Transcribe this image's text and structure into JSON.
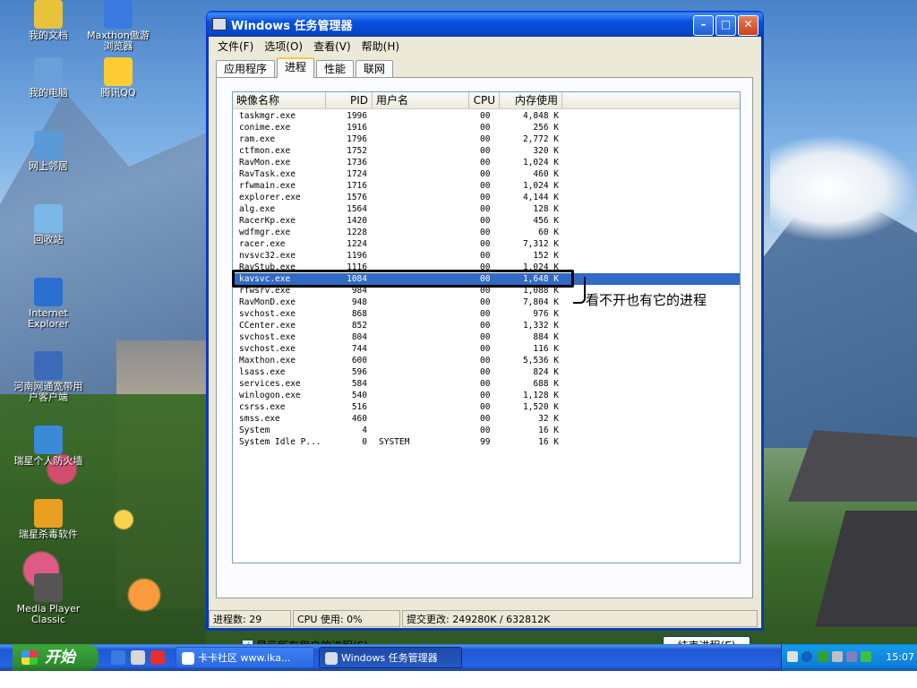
{
  "desktop": {
    "icons": [
      {
        "label": "我的文档",
        "color": "#e8c23a"
      },
      {
        "label": "Maxthon傲游浏览器",
        "color": "#3a7ae0"
      },
      {
        "label": "我的电脑",
        "color": "#6aa0d8"
      },
      {
        "label": "腾讯QQ",
        "color": "#ffcc33"
      },
      {
        "label": "网上邻居",
        "color": "#5a9ad8"
      },
      {
        "label": "回收站",
        "color": "#7ab8e8"
      },
      {
        "label": "Internet Explorer",
        "color": "#2a70d0"
      },
      {
        "label": "河南网通宽带用户客户端",
        "color": "#3a6ab8"
      },
      {
        "label": "瑞星个人防火墙",
        "color": "#3a8ad8"
      },
      {
        "label": "瑞星杀毒软件",
        "color": "#e8a020"
      },
      {
        "label": "Media Player Classic",
        "color": "#555555"
      }
    ]
  },
  "window": {
    "title": "Windows 任务管理器",
    "menu": [
      "文件(F)",
      "选项(O)",
      "查看(V)",
      "帮助(H)"
    ],
    "tabs": [
      "应用程序",
      "进程",
      "性能",
      "联网"
    ],
    "active_tab": "进程",
    "columns": [
      "映像名称",
      "PID",
      "用户名",
      "CPU",
      "内存使用"
    ],
    "processes": [
      {
        "name": "taskmgr.exe",
        "pid": "1996",
        "user": "",
        "cpu": "00",
        "mem": "4,848 K"
      },
      {
        "name": "conime.exe",
        "pid": "1916",
        "user": "",
        "cpu": "00",
        "mem": "256 K"
      },
      {
        "name": "ram.exe",
        "pid": "1796",
        "user": "",
        "cpu": "00",
        "mem": "2,772 K"
      },
      {
        "name": "ctfmon.exe",
        "pid": "1752",
        "user": "",
        "cpu": "00",
        "mem": "320 K"
      },
      {
        "name": "RavMon.exe",
        "pid": "1736",
        "user": "",
        "cpu": "00",
        "mem": "1,024 K"
      },
      {
        "name": "RavTask.exe",
        "pid": "1724",
        "user": "",
        "cpu": "00",
        "mem": "460 K"
      },
      {
        "name": "rfwmain.exe",
        "pid": "1716",
        "user": "",
        "cpu": "00",
        "mem": "1,024 K"
      },
      {
        "name": "explorer.exe",
        "pid": "1576",
        "user": "",
        "cpu": "00",
        "mem": "4,144 K"
      },
      {
        "name": "alg.exe",
        "pid": "1564",
        "user": "",
        "cpu": "00",
        "mem": "128 K"
      },
      {
        "name": "RacerKp.exe",
        "pid": "1420",
        "user": "",
        "cpu": "00",
        "mem": "456 K"
      },
      {
        "name": "wdfmgr.exe",
        "pid": "1228",
        "user": "",
        "cpu": "00",
        "mem": "60 K"
      },
      {
        "name": "racer.exe",
        "pid": "1224",
        "user": "",
        "cpu": "00",
        "mem": "7,312 K"
      },
      {
        "name": "nvsvc32.exe",
        "pid": "1196",
        "user": "",
        "cpu": "00",
        "mem": "152 K"
      },
      {
        "name": "RavStub.exe",
        "pid": "1116",
        "user": "",
        "cpu": "00",
        "mem": "1,024 K"
      },
      {
        "name": "kavsvc.exe",
        "pid": "1084",
        "user": "",
        "cpu": "00",
        "mem": "1,648 K",
        "selected": true
      },
      {
        "name": "rfwsrv.exe",
        "pid": "984",
        "user": "",
        "cpu": "00",
        "mem": "1,088 K"
      },
      {
        "name": "RavMonD.exe",
        "pid": "948",
        "user": "",
        "cpu": "00",
        "mem": "7,804 K"
      },
      {
        "name": "svchost.exe",
        "pid": "868",
        "user": "",
        "cpu": "00",
        "mem": "976 K"
      },
      {
        "name": "CCenter.exe",
        "pid": "852",
        "user": "",
        "cpu": "00",
        "mem": "1,332 K"
      },
      {
        "name": "svchost.exe",
        "pid": "804",
        "user": "",
        "cpu": "00",
        "mem": "884 K"
      },
      {
        "name": "svchost.exe",
        "pid": "744",
        "user": "",
        "cpu": "00",
        "mem": "116 K"
      },
      {
        "name": "Maxthon.exe",
        "pid": "600",
        "user": "",
        "cpu": "00",
        "mem": "5,536 K"
      },
      {
        "name": "lsass.exe",
        "pid": "596",
        "user": "",
        "cpu": "00",
        "mem": "824 K"
      },
      {
        "name": "services.exe",
        "pid": "584",
        "user": "",
        "cpu": "00",
        "mem": "688 K"
      },
      {
        "name": "winlogon.exe",
        "pid": "540",
        "user": "",
        "cpu": "00",
        "mem": "1,128 K"
      },
      {
        "name": "csrss.exe",
        "pid": "516",
        "user": "",
        "cpu": "00",
        "mem": "1,520 K"
      },
      {
        "name": "smss.exe",
        "pid": "460",
        "user": "",
        "cpu": "00",
        "mem": "32 K"
      },
      {
        "name": "System",
        "pid": "4",
        "user": "",
        "cpu": "00",
        "mem": "16 K"
      },
      {
        "name": "System Idle P...",
        "pid": "0",
        "user": "SYSTEM",
        "cpu": "99",
        "mem": "16 K"
      }
    ],
    "show_all_users_label": "显示所有用户的进程(S)",
    "show_all_users_checked": true,
    "end_process_label": "结束进程(E)",
    "status": {
      "process_count": "进程数: 29",
      "cpu_usage": "CPU 使用: 0%",
      "commit_charge": "提交更改: 249280K / 632812K"
    }
  },
  "annotation": {
    "text": "看不开也有它的进程"
  },
  "taskbar": {
    "start_label": "开始",
    "items": [
      {
        "label": "卡卡社区 www.ika...",
        "active": false
      },
      {
        "label": "Windows 任务管理器",
        "active": true
      }
    ],
    "clock": "15:07"
  }
}
